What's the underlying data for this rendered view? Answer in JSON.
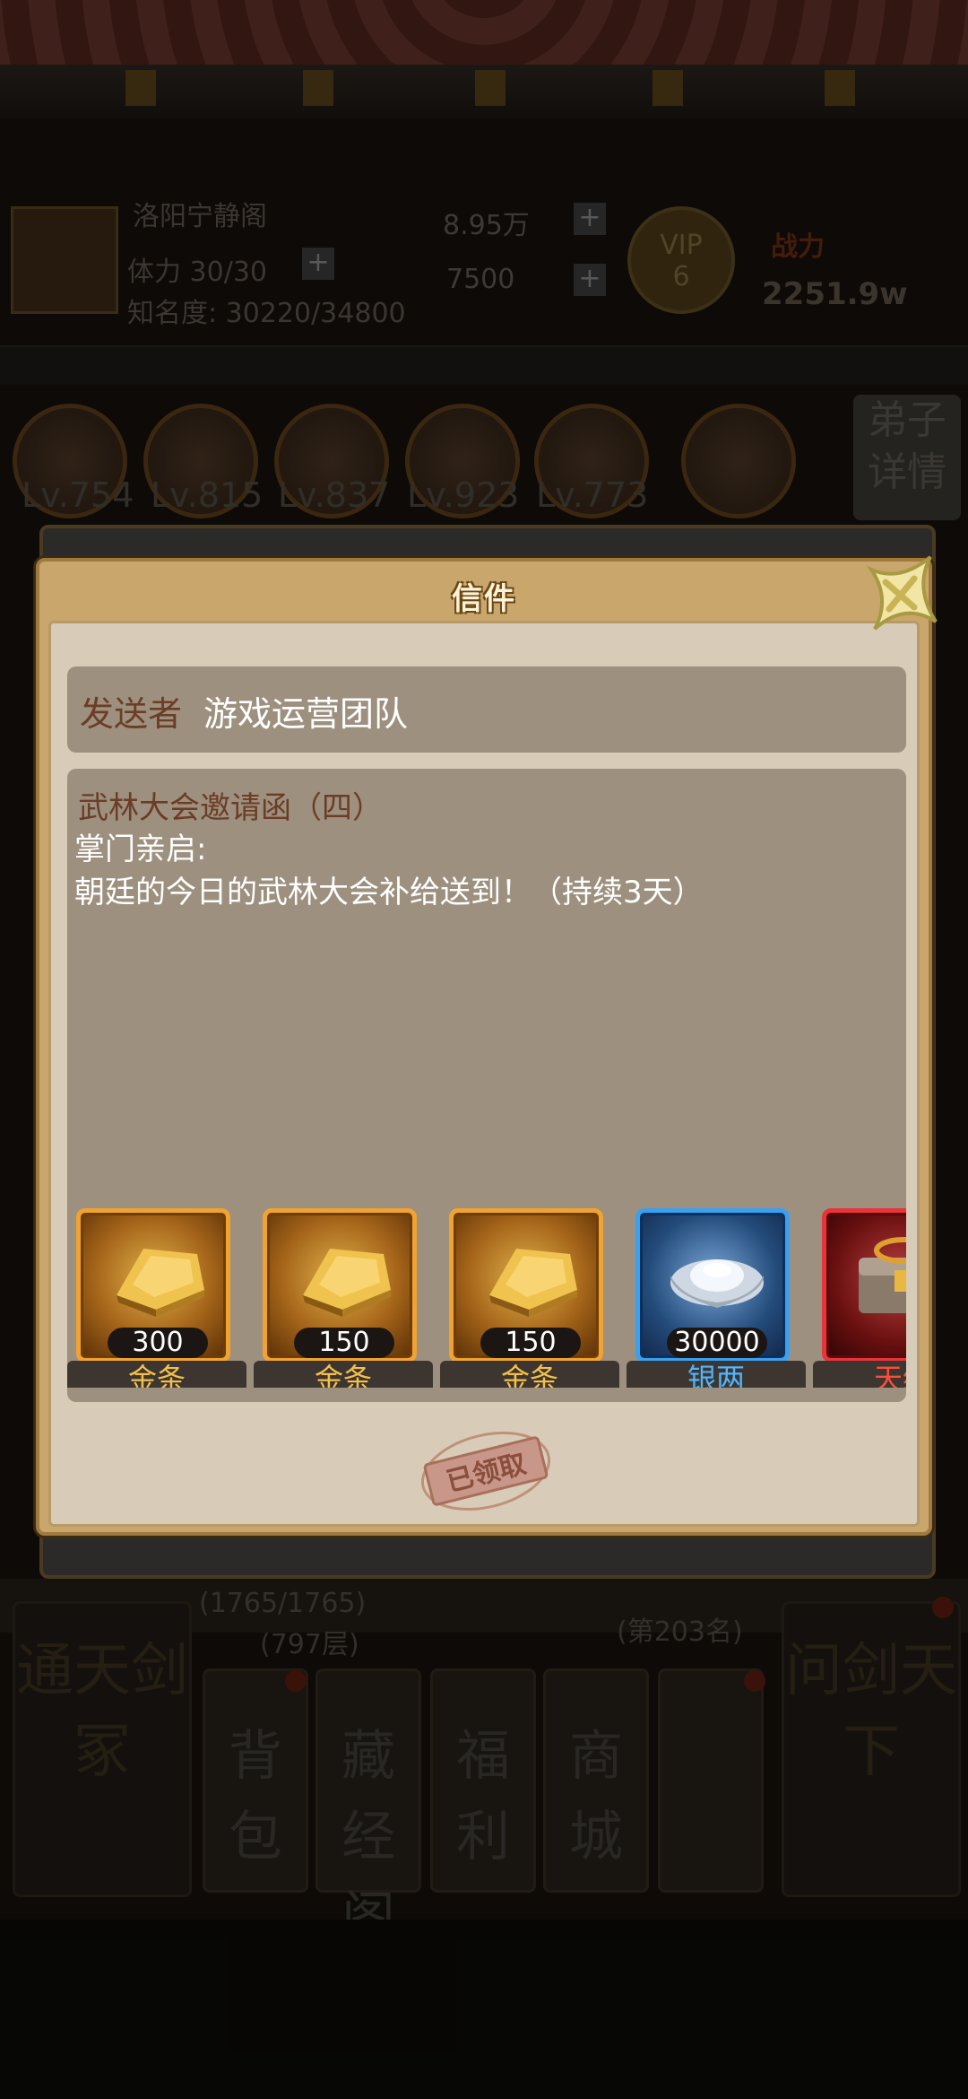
{
  "background": {
    "location_name": "洛阳宁静阁",
    "stamina": "体力 30/30",
    "fame": "知名度: 30220/34800",
    "silver_amount": "8.95万",
    "gold_amount": "7500",
    "vip_label": "VIP",
    "vip_level": "6",
    "power_label": "战力",
    "power_value": "2251.9w",
    "heroes": [
      {
        "level": "Lv.754"
      },
      {
        "level": "Lv.815"
      },
      {
        "level": "Lv.837"
      },
      {
        "level": "Lv.923"
      },
      {
        "level": "Lv.773"
      }
    ],
    "disciple_details": "弟子详情",
    "tower_progress": "(1765/1765)",
    "tower_floor": "(797层)",
    "rank": "(第203名)",
    "menu": {
      "left_tile": "通天剑冢",
      "bag": "背包",
      "library": "藏经阁",
      "welfare": "福利",
      "shop": "商城",
      "right_tile": "问剑天下"
    }
  },
  "dialog": {
    "title": "信件",
    "sender_label": "发送者",
    "sender_name": "游戏运营团队",
    "subject": "武林大会邀请函（四）",
    "greeting": "掌门亲启:",
    "message": "朝廷的今日的武林大会补给送到！（持续3天）",
    "rewards": [
      {
        "name": "金条",
        "count": "300",
        "rarity": "gold"
      },
      {
        "name": "金条",
        "count": "150",
        "rarity": "gold"
      },
      {
        "name": "金条",
        "count": "150",
        "rarity": "gold"
      },
      {
        "name": "银两",
        "count": "30000",
        "rarity": "blue"
      },
      {
        "name": "天绝",
        "count": "",
        "rarity": "red"
      }
    ],
    "claimed_stamp": "已领取"
  },
  "colors": {
    "dialog_frame": "#c9a66b",
    "inner_panel": "#d8ccb9",
    "text_box": "#9d907f",
    "label_brown": "#6b3d27",
    "gold_name": "#f4c04a",
    "blue_name": "#4fb6ff",
    "red_name": "#ff4b3a"
  }
}
